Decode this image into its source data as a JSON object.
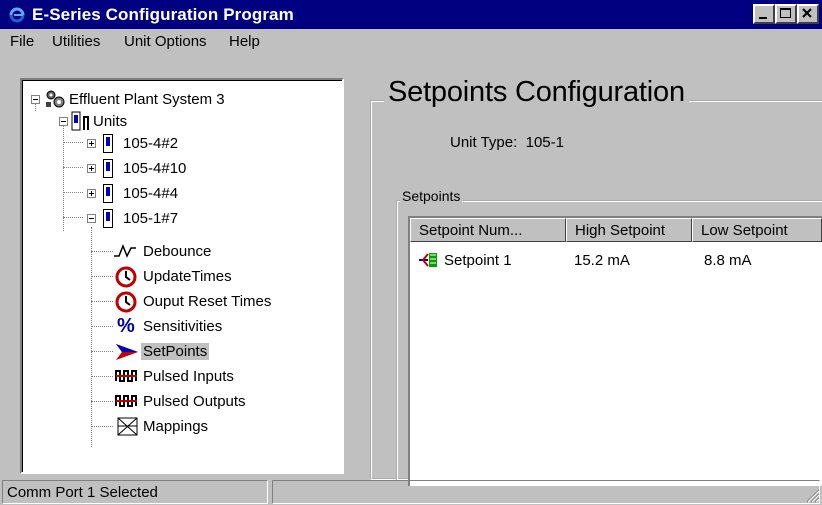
{
  "window": {
    "title": "E-Series Configuration Program",
    "title_bg": "#000080"
  },
  "menu": {
    "items": [
      "File",
      "Utilities",
      "Unit Options",
      "Help"
    ]
  },
  "tree": {
    "root": "Effluent Plant System 3",
    "units": "Units",
    "unit_items": [
      "105-4#2",
      "105-4#10",
      "105-4#4",
      "105-1#7"
    ],
    "children": [
      {
        "label": "Debounce",
        "icon": "debounce-icon"
      },
      {
        "label": "UpdateTimes",
        "icon": "clock-icon"
      },
      {
        "label": "Ouput Reset Times",
        "icon": "clock-icon"
      },
      {
        "label": "Sensitivities",
        "icon": "percent-icon"
      },
      {
        "label": "SetPoints",
        "icon": "setpoint-arrow-icon",
        "selected": true
      },
      {
        "label": "Pulsed Inputs",
        "icon": "pulse-icon"
      },
      {
        "label": "Pulsed Outputs",
        "icon": "pulse-icon"
      },
      {
        "label": "Mappings",
        "icon": "mappings-icon"
      }
    ]
  },
  "config": {
    "title": "Setpoints Configuration",
    "unit_type_label": "Unit Type:",
    "unit_type_value": "105-1",
    "group_label": "Setpoints",
    "columns": [
      "Setpoint Num...",
      "High Setpoint",
      "Low Setpoint"
    ],
    "rows": [
      {
        "name": "Setpoint 1",
        "high": "15.2 mA",
        "low": "8.8 mA"
      }
    ]
  },
  "status": {
    "text": "Comm Port 1 Selected"
  }
}
